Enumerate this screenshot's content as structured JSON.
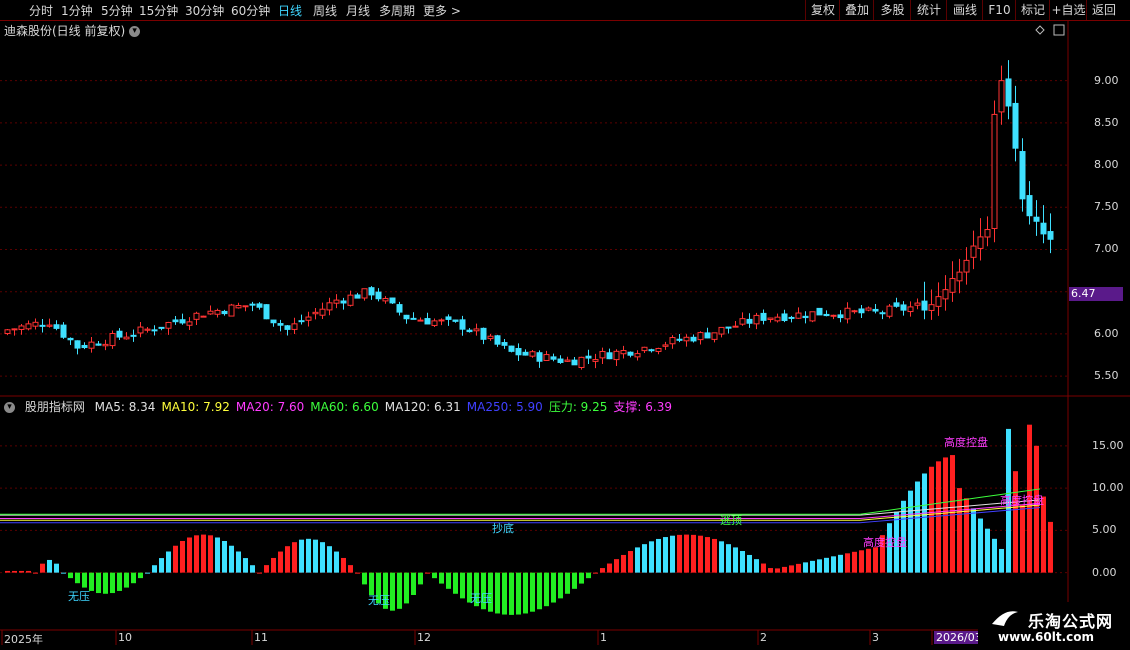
{
  "toolbar": {
    "tabs": [
      {
        "label": "分时",
        "x": 29
      },
      {
        "label": "1分钟",
        "x": 61
      },
      {
        "label": "5分钟",
        "x": 101
      },
      {
        "label": "15分钟",
        "x": 139
      },
      {
        "label": "30分钟",
        "x": 185
      },
      {
        "label": "60分钟",
        "x": 231
      },
      {
        "label": "日线",
        "x": 278
      },
      {
        "label": "周线",
        "x": 313
      },
      {
        "label": "月线",
        "x": 346
      },
      {
        "label": "多周期",
        "x": 379
      },
      {
        "label": "更多 >",
        "x": 423
      }
    ],
    "active_tab": "日线",
    "buttons": [
      "复权",
      "叠加",
      "多股",
      "统计",
      "画线",
      "F10",
      "标记",
      "+自选",
      "返回"
    ]
  },
  "chart_title": "迪森股份(日线 前复权)",
  "price_axis": {
    "ticks": [
      "9.00",
      "8.50",
      "8.00",
      "7.50",
      "7.00",
      "6.00",
      "5.50"
    ],
    "current_price": "6.47",
    "ylim": [
      5.3,
      9.6
    ]
  },
  "indicator": {
    "name": "股朋指标网",
    "values": [
      {
        "label": "MA5: 8.34",
        "color": "#e0e0e0"
      },
      {
        "label": "MA10: 7.92",
        "color": "#ffff3c"
      },
      {
        "label": "MA20: 7.60",
        "color": "#ff3cff"
      },
      {
        "label": "MA60: 6.60",
        "color": "#3cff3c"
      },
      {
        "label": "MA120: 6.31",
        "color": "#e0e0e0"
      },
      {
        "label": "MA250: 5.90",
        "color": "#4040ff"
      },
      {
        "label": "压力: 9.25",
        "color": "#3cff3c"
      },
      {
        "label": "支撑: 6.39",
        "color": "#ff3cff"
      }
    ],
    "axis_ticks": [
      "15.00",
      "10.00",
      "5.00",
      "0.00"
    ],
    "annotations": [
      {
        "text": "无压",
        "color": "#3fd6ff"
      },
      {
        "text": "无压",
        "color": "#3fd6ff"
      },
      {
        "text": "无压",
        "color": "#3fd6ff"
      },
      {
        "text": "抄底",
        "color": "#3fd6ff"
      },
      {
        "text": "逃顶",
        "color": "#3cff3c"
      },
      {
        "text": "高度控盘",
        "color": "#ff3cff"
      },
      {
        "text": "高度控盘",
        "color": "#ff3cff"
      },
      {
        "text": "高度控盘",
        "color": "#ff3cff"
      }
    ]
  },
  "time_axis": {
    "labels": [
      "2025年",
      "10",
      "11",
      "12",
      "1",
      "2",
      "3",
      "2026/03"
    ]
  },
  "watermark": {
    "line1": "乐淘公式网",
    "line2": "www.60lt.com"
  },
  "colors": {
    "up": "#ff3333",
    "down": "#3fe0ff",
    "bg": "#000000",
    "grid": "#5a0000"
  }
}
